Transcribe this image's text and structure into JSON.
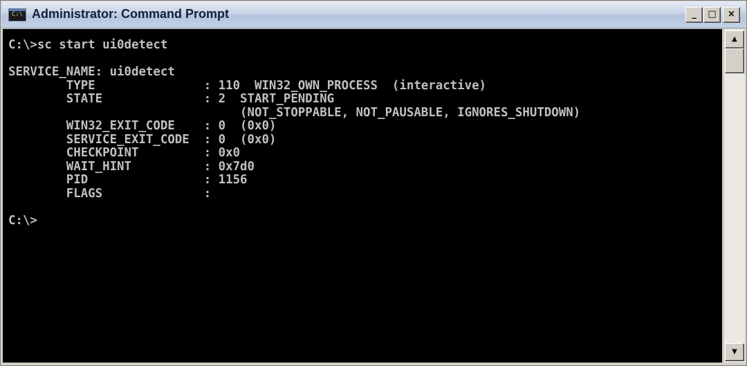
{
  "window": {
    "title": "Administrator: Command Prompt",
    "icon": "cmd-icon",
    "icon_text": "C:\\",
    "controls": {
      "minimize": "_",
      "maximize": "□",
      "close": "×"
    }
  },
  "console": {
    "text": "C:\\>sc start ui0detect\n\nSERVICE_NAME: ui0detect\n        TYPE               : 110  WIN32_OWN_PROCESS  (interactive)\n        STATE              : 2  START_PENDING\n                                (NOT_STOPPABLE, NOT_PAUSABLE, IGNORES_SHUTDOWN)\n        WIN32_EXIT_CODE    : 0  (0x0)\n        SERVICE_EXIT_CODE  : 0  (0x0)\n        CHECKPOINT         : 0x0\n        WAIT_HINT          : 0x7d0\n        PID                : 1156\n        FLAGS              :\n\nC:\\>",
    "foreground": "#c0c0c0",
    "background": "#000000"
  },
  "scrollbar": {
    "up_arrow": "▲",
    "down_arrow": "▼"
  }
}
